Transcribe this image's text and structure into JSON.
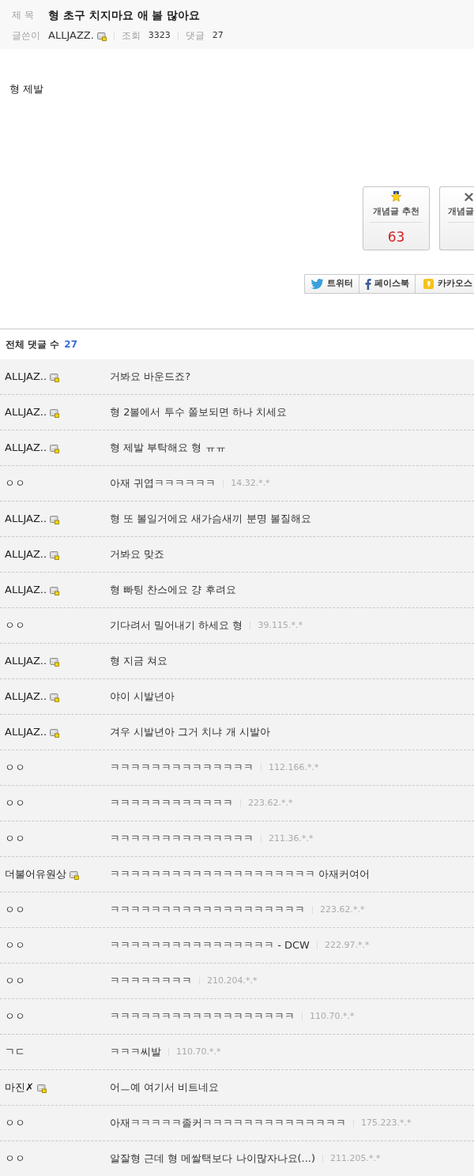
{
  "post": {
    "title_label": "제 목",
    "title": "형 초구 치지마요 애 볼 많아요",
    "author_label": "글쓴이",
    "author": "ALLJAZZ.",
    "author_member": true,
    "views_label": "조회",
    "views": "3323",
    "comments_label": "댓글",
    "comments": "27"
  },
  "body": {
    "text": "형 제발"
  },
  "votes": [
    {
      "kind": "up",
      "label": "개념글 추천",
      "count": "63"
    },
    {
      "kind": "down",
      "label": "개념글"
    }
  ],
  "share": [
    {
      "kind": "twitter",
      "label": "트위터"
    },
    {
      "kind": "facebook",
      "label": "페이스북"
    },
    {
      "kind": "kakao",
      "label": "카카오스"
    }
  ],
  "comment_list": {
    "label": "전체 댓글 수",
    "count": "27",
    "rows": [
      {
        "name": "ALLJAZ..",
        "member": true,
        "text": "거봐요 바운드죠?"
      },
      {
        "name": "ALLJAZ..",
        "member": true,
        "text": "형 2볼에서 투수 쫄보되면 하나 치세요"
      },
      {
        "name": "ALLJAZ..",
        "member": true,
        "text": "형 제발 부탁해요 형 ㅠㅠ"
      },
      {
        "name": "ㅇㅇ",
        "member": false,
        "text": "아재 귀엽ㅋㅋㅋㅋㅋㅋ",
        "ip": "14.32.*.*"
      },
      {
        "name": "ALLJAZ..",
        "member": true,
        "text": "형 또 볼일거에요 새가슴새끼 분명 볼질해요"
      },
      {
        "name": "ALLJAZ..",
        "member": true,
        "text": "거봐요 맞죠"
      },
      {
        "name": "ALLJAZ..",
        "member": true,
        "text": "형 빠팅 찬스에요 걍 후려요"
      },
      {
        "name": "ㅇㅇ",
        "member": false,
        "text": "기다려서 밀어내기 하세요 형",
        "ip": "39.115.*.*"
      },
      {
        "name": "ALLJAZ..",
        "member": true,
        "text": "형 지금 쳐요"
      },
      {
        "name": "ALLJAZ..",
        "member": true,
        "text": "야이 시발년아"
      },
      {
        "name": "ALLJAZ..",
        "member": true,
        "text": "겨우 시발년아 그거 치냐 개 시발아"
      },
      {
        "name": "ㅇㅇ",
        "member": false,
        "text": "ㅋㅋㅋㅋㅋㅋㅋㅋㅋㅋㅋㅋㅋㅋ",
        "ip": "112.166.*.*"
      },
      {
        "name": "ㅇㅇ",
        "member": false,
        "text": "ㅋㅋㅋㅋㅋㅋㅋㅋㅋㅋㅋㅋ",
        "ip": "223.62.*.*"
      },
      {
        "name": "ㅇㅇ",
        "member": false,
        "text": "ㅋㅋㅋㅋㅋㅋㅋㅋㅋㅋㅋㅋㅋㅋ",
        "ip": "211.36.*.*"
      },
      {
        "name": "더불어유원상",
        "member": true,
        "text": "ㅋㅋㅋㅋㅋㅋㅋㅋㅋㅋㅋㅋㅋㅋㅋㅋㅋㅋㅋㅋ 아재커여어"
      },
      {
        "name": "ㅇㅇ",
        "member": false,
        "text": "ㅋㅋㅋㅋㅋㅋㅋㅋㅋㅋㅋㅋㅋㅋㅋㅋㅋㅋㅋ",
        "ip": "223.62.*.*"
      },
      {
        "name": "ㅇㅇ",
        "member": false,
        "text": "ㅋㅋㅋㅋㅋㅋㅋㅋㅋㅋㅋㅋㅋㅋㅋㅋ - DCW",
        "ip": "222.97.*.*"
      },
      {
        "name": "ㅇㅇ",
        "member": false,
        "text": "ㅋㅋㅋㅋㅋㅋㅋㅋ",
        "ip": "210.204.*.*"
      },
      {
        "name": "ㅇㅇ",
        "member": false,
        "text": "ㅋㅋㅋㅋㅋㅋㅋㅋㅋㅋㅋㅋㅋㅋㅋㅋㅋㅋ",
        "ip": "110.70.*.*"
      },
      {
        "name": "ㄱㄷ",
        "member": false,
        "text": "ㅋㅋㅋ씨발",
        "ip": "110.70.*.*"
      },
      {
        "name": "마진✗",
        "member": true,
        "text": "어ㅡ예 여기서 비트네요"
      },
      {
        "name": "ㅇㅇ",
        "member": false,
        "text": "아재ㅋㅋㅋㅋㅋ졸커ㅋㅋㅋㅋㅋㅋㅋㅋㅋㅋㅋㅋㅋㅋ",
        "ip": "175.223.*.*"
      },
      {
        "name": "ㅇㅇ",
        "member": false,
        "text": "알잘형 근데 형 메쌀택보다 나이많자나요(...)",
        "ip": "211.205.*.*"
      }
    ]
  }
}
